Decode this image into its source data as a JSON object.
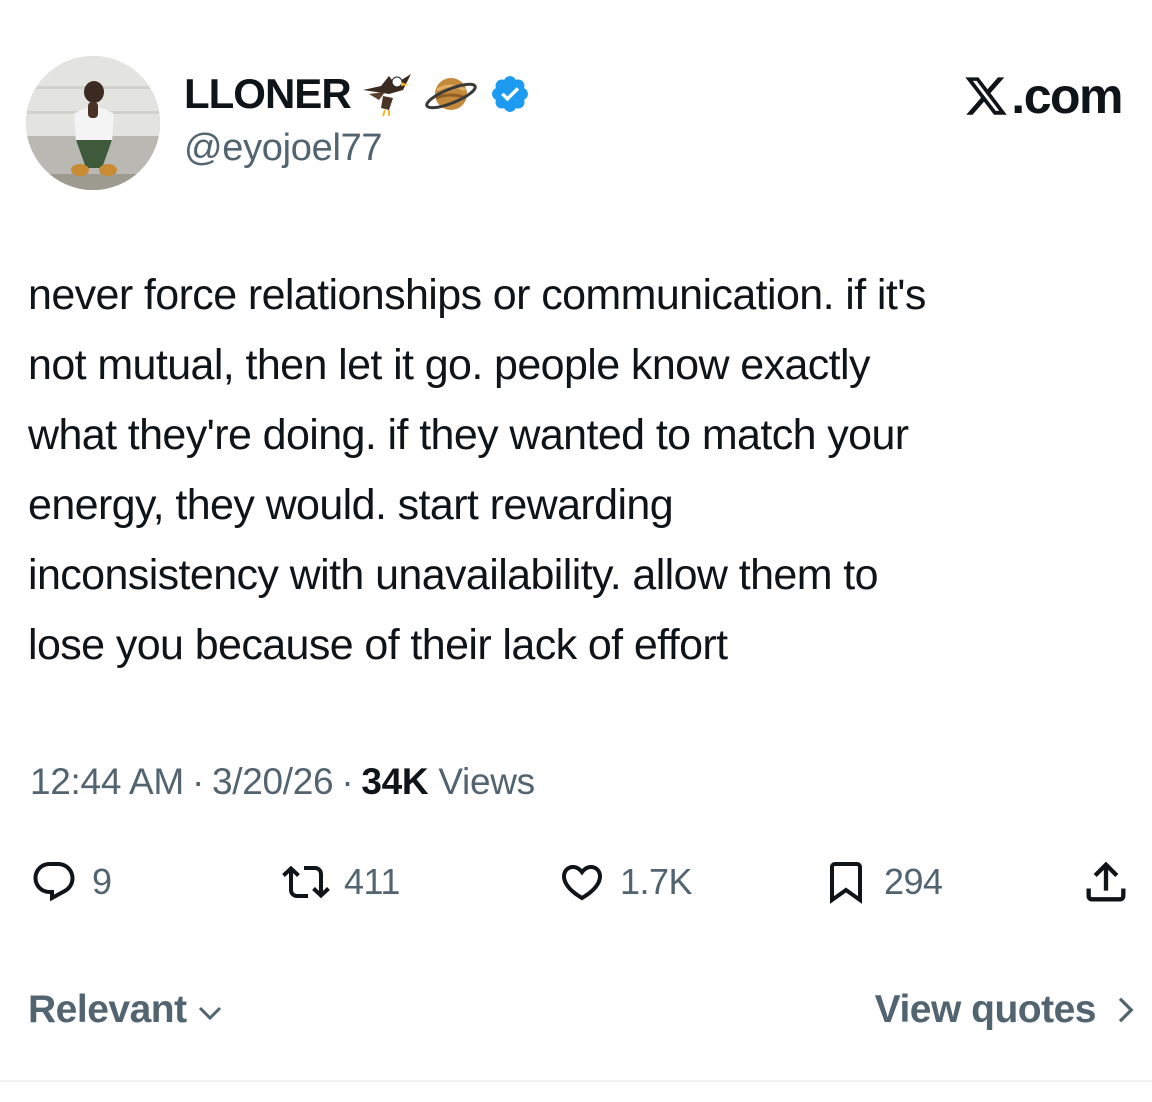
{
  "author": {
    "display_name": "LLONER",
    "handle": "@eyojoel77",
    "emojis": [
      "eagle-icon",
      "ringed-planet-icon"
    ],
    "verified": true
  },
  "brand": {
    "text": ".com",
    "logo": "x-logo-icon"
  },
  "tweet": {
    "text": "never force relationships or communication. if it's\nnot mutual, then let it go. people know exactly\nwhat they're doing. if they wanted to match your\nenergy, they would. start rewarding\ninconsistency with unavailability. allow them to\nlose you because of their lack of effort"
  },
  "meta": {
    "time": "12:44 AM",
    "separator": "·",
    "date": "3/20/26",
    "views_count": "34K",
    "views_label": "Views"
  },
  "actions": {
    "replies": "9",
    "reposts": "411",
    "likes": "1.7K",
    "bookmarks": "294"
  },
  "footer": {
    "sort_label": "Relevant",
    "quotes_label": "View quotes"
  },
  "colors": {
    "text_primary": "#0f1419",
    "text_secondary": "#536471",
    "verified_blue": "#1d9bf0",
    "divider": "#eff3f4"
  }
}
